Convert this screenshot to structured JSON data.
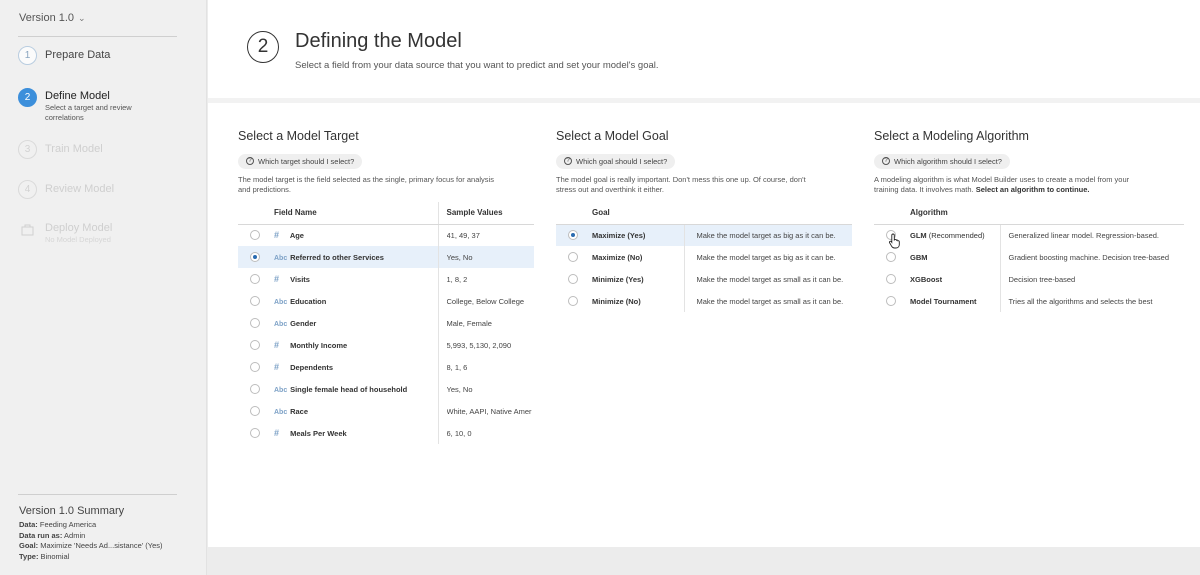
{
  "sidebar": {
    "version_label": "Version 1.0",
    "steps": [
      {
        "num": "1",
        "title": "Prepare Data",
        "sub": ""
      },
      {
        "num": "2",
        "title": "Define Model",
        "sub": "Select a target and review correlations"
      },
      {
        "num": "3",
        "title": "Train Model",
        "sub": ""
      },
      {
        "num": "4",
        "title": "Review Model",
        "sub": ""
      },
      {
        "num": "",
        "title": "Deploy Model",
        "sub": "No Model Deployed"
      }
    ],
    "summary": {
      "title": "Version 1.0 Summary",
      "data_label": "Data:",
      "data_value": "Feeding America",
      "run_label": "Data run as:",
      "run_value": "Admin",
      "goal_label": "Goal:",
      "goal_value": "Maximize 'Needs Ad...sistance' (Yes)",
      "type_label": "Type:",
      "type_value": "Binomial"
    }
  },
  "header": {
    "step_number": "2",
    "title": "Defining the Model",
    "subtitle": "Select a field from your data source that you want to predict and set your model's goal."
  },
  "target": {
    "title": "Select a Model Target",
    "help": "Which target should I select?",
    "desc": "The model target is the field selected as the single, primary focus for analysis and predictions.",
    "col_field": "Field Name",
    "col_values": "Sample Values",
    "rows": [
      {
        "type": "#",
        "name": "Age",
        "values": "41, 49, 37"
      },
      {
        "type": "Abc",
        "name": "Referred to other Services",
        "values": "Yes, No"
      },
      {
        "type": "#",
        "name": "Visits",
        "values": "1, 8, 2"
      },
      {
        "type": "Abc",
        "name": "Education",
        "values": "College, Below College"
      },
      {
        "type": "Abc",
        "name": "Gender",
        "values": "Male, Female"
      },
      {
        "type": "#",
        "name": "Monthly Income",
        "values": "5,993, 5,130, 2,090"
      },
      {
        "type": "#",
        "name": "Dependents",
        "values": "8, 1, 6"
      },
      {
        "type": "Abc",
        "name": "Single female head of household",
        "values": "Yes, No"
      },
      {
        "type": "Abc",
        "name": "Race",
        "values": "White, AAPI, Native Amer"
      },
      {
        "type": "#",
        "name": "Meals Per Week",
        "values": "6, 10, 0"
      }
    ]
  },
  "goal": {
    "title": "Select a Model Goal",
    "help": "Which goal should I select?",
    "desc": "The model goal is really important. Don't mess this one up. Of course, don't stress out and overthink it either.",
    "col_goal": "Goal",
    "rows": [
      {
        "name": "Maximize (Yes)",
        "desc": "Make the model target as big as it can be."
      },
      {
        "name": "Maximize (No)",
        "desc": "Make the model target as big as it can be."
      },
      {
        "name": "Minimize (Yes)",
        "desc": "Make the model target as small as it can be."
      },
      {
        "name": "Minimize (No)",
        "desc": "Make the model target as small as it can be."
      }
    ]
  },
  "algorithm": {
    "title": "Select a Modeling Algorithm",
    "help": "Which algorithm should I select?",
    "desc_plain": "A modeling algorithm is what Model Builder uses to create a model from your training data. It involves math.",
    "desc_bold": "Select an algorithm to continue.",
    "col_alg": "Algorithm",
    "rows": [
      {
        "name": "GLM",
        "suffix": "(Recommended)",
        "desc": "Generalized linear model. Regression-based."
      },
      {
        "name": "GBM",
        "suffix": "",
        "desc": "Gradient boosting machine. Decision tree-based"
      },
      {
        "name": "XGBoost",
        "suffix": "",
        "desc": "Decision tree-based"
      },
      {
        "name": "Model Tournament",
        "suffix": "",
        "desc": "Tries all the algorithms and selects the best"
      }
    ]
  },
  "icons": {
    "version_chevron": "chevron-down-icon",
    "help": "question-circle-icon",
    "number_type": "hash-icon",
    "string_type": "abc-icon",
    "deploy": "deploy-icon",
    "cursor": "hand-pointer-icon"
  },
  "colors": {
    "accent": "#3c8fdb",
    "selected_row": "#e7f0fa"
  }
}
